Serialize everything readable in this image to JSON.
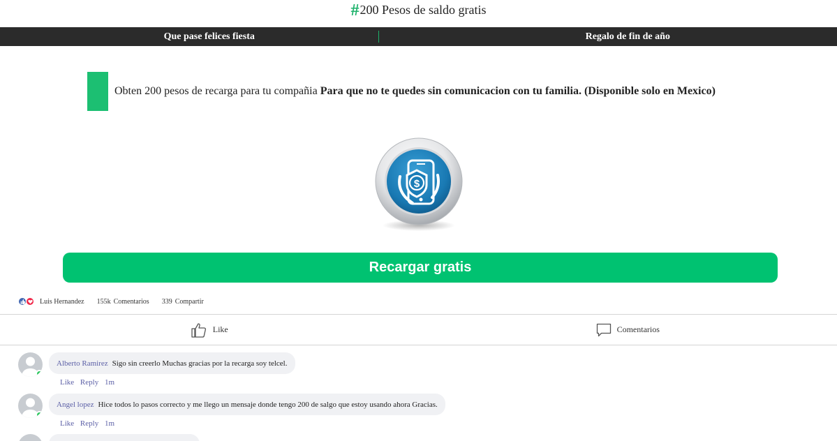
{
  "header": {
    "hash_symbol": "#",
    "title": "200 Pesos de saldo gratis"
  },
  "nav": {
    "left": "Que pase felices fiesta",
    "right": "Regalo de fin de año"
  },
  "promo": {
    "text": "Obten 200 pesos de recarga para tu compañia ",
    "bold_text": "Para que no te quedes sin comunicacion con tu familia. (Disponible solo en Mexico)"
  },
  "hero_icon": "money-phone-icon",
  "cta": {
    "label": "Recargar gratis"
  },
  "stats": {
    "reactor": "Luis Hernandez",
    "comments_count": "155k",
    "comments_label": "Comentarios",
    "shares_count": "339",
    "shares_label": "Compartir"
  },
  "actions": {
    "like": "Like",
    "comment": "Comentarios"
  },
  "comments": [
    {
      "author": "Alberto Ramirez",
      "text": "Sigo sin creerlo Muchas gracias por la recarga soy telcel.",
      "like": "Like",
      "reply": "Reply",
      "time": "1m"
    },
    {
      "author": "Angel lopez",
      "text": "Hice todos lo pasos correcto y me llego un mensaje donde tengo 200 de salgo que estoy usando ahora Gracias.",
      "like": "Like",
      "reply": "Reply",
      "time": "1m"
    }
  ],
  "colors": {
    "accent": "#00c271",
    "nav_bg": "#2b2b2b",
    "link": "#5b5fa6"
  }
}
